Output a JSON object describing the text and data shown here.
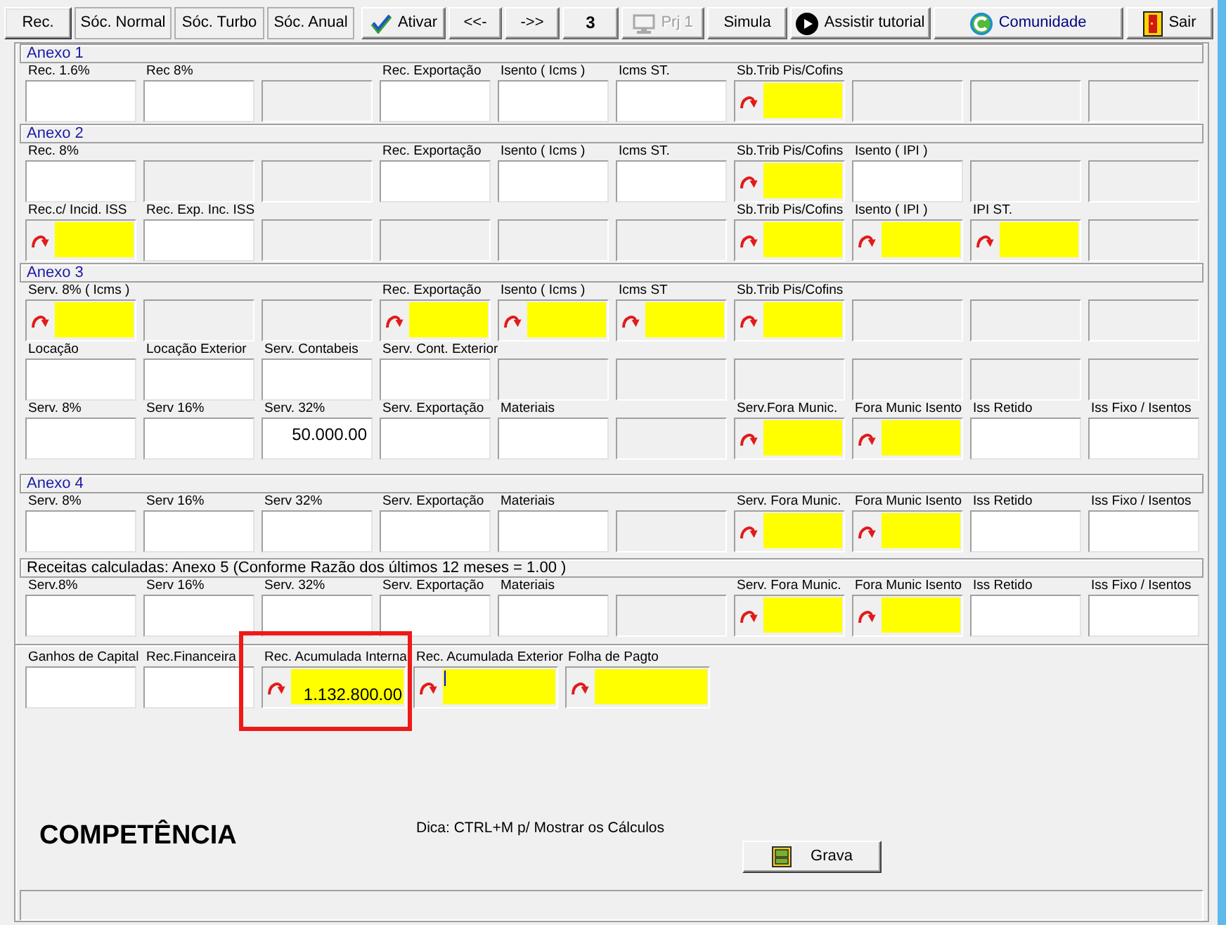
{
  "tabs": [
    {
      "label": "Rec.",
      "selected": true
    },
    {
      "label": "Sóc. Normal",
      "selected": false
    },
    {
      "label": "Sóc. Turbo",
      "selected": false
    },
    {
      "label": "Sóc. Anual",
      "selected": false
    }
  ],
  "toolbar": [
    {
      "kind": "activate",
      "label": "Ativar",
      "disabled": false
    },
    {
      "kind": "plain",
      "label": "<<-",
      "disabled": false
    },
    {
      "kind": "plain",
      "label": "->>",
      "disabled": false
    },
    {
      "kind": "counter",
      "label": "3",
      "disabled": false
    },
    {
      "kind": "project",
      "label": "Prj 1",
      "disabled": true
    },
    {
      "kind": "plain",
      "label": "Simula",
      "disabled": false
    },
    {
      "kind": "tutorial",
      "label": "Assistir tutorial",
      "disabled": false
    },
    {
      "kind": "community",
      "label": "Comunidade",
      "disabled": false
    },
    {
      "kind": "exit",
      "label": "Sair",
      "disabled": false
    }
  ],
  "sections": [
    {
      "kind": "annex",
      "title": "Anexo 1",
      "rows": [
        [
          {
            "kind": "input",
            "label": "Rec. 1.6%"
          },
          {
            "kind": "input",
            "label": "Rec 8%"
          },
          {
            "kind": "off"
          },
          {
            "kind": "input",
            "label": "Rec. Exportação"
          },
          {
            "kind": "input",
            "label": "Isento ( Icms )"
          },
          {
            "kind": "input",
            "label": "Icms ST."
          },
          {
            "kind": "calc",
            "label": "Sb.Trib Pis/Cofins"
          },
          {
            "kind": "off"
          },
          {
            "kind": "off"
          },
          {
            "kind": "off"
          }
        ]
      ]
    },
    {
      "kind": "annex",
      "title": "Anexo 2",
      "rows": [
        [
          {
            "kind": "input",
            "label": "Rec. 8%"
          },
          {
            "kind": "off"
          },
          {
            "kind": "off"
          },
          {
            "kind": "input",
            "label": "Rec. Exportação"
          },
          {
            "kind": "input",
            "label": "Isento ( Icms )"
          },
          {
            "kind": "input",
            "label": "Icms ST."
          },
          {
            "kind": "calc",
            "label": "Sb.Trib Pis/Cofins"
          },
          {
            "kind": "input",
            "label": "Isento ( IPI )"
          },
          {
            "kind": "off"
          },
          {
            "kind": "off"
          }
        ],
        [
          {
            "kind": "calc",
            "label": "Rec.c/ Incid. ISS"
          },
          {
            "kind": "input",
            "label": "Rec. Exp. Inc. ISS"
          },
          {
            "kind": "off"
          },
          {
            "kind": "off"
          },
          {
            "kind": "off"
          },
          {
            "kind": "off"
          },
          {
            "kind": "calc",
            "label": "Sb.Trib Pis/Cofins"
          },
          {
            "kind": "calc",
            "label": "Isento ( IPI )"
          },
          {
            "kind": "calc",
            "label": "IPI ST."
          },
          {
            "kind": "off"
          }
        ]
      ]
    },
    {
      "kind": "annex",
      "title": "Anexo 3",
      "rows": [
        [
          {
            "kind": "calc",
            "label": "Serv. 8% ( Icms )"
          },
          {
            "kind": "off"
          },
          {
            "kind": "off"
          },
          {
            "kind": "calc",
            "label": "Rec. Exportação"
          },
          {
            "kind": "calc",
            "label": "Isento ( Icms )"
          },
          {
            "kind": "calc",
            "label": "Icms ST"
          },
          {
            "kind": "calc",
            "label": "Sb.Trib Pis/Cofins"
          },
          {
            "kind": "off"
          },
          {
            "kind": "off"
          },
          {
            "kind": "off"
          }
        ],
        [
          {
            "kind": "input",
            "label": "Locação"
          },
          {
            "kind": "input",
            "label": "Locação Exterior"
          },
          {
            "kind": "input",
            "label": "Serv. Contabeis"
          },
          {
            "kind": "input",
            "label": "Serv. Cont. Exterior"
          },
          {
            "kind": "off"
          },
          {
            "kind": "off"
          },
          {
            "kind": "off"
          },
          {
            "kind": "off"
          },
          {
            "kind": "off"
          },
          {
            "kind": "off"
          }
        ],
        [
          {
            "kind": "input",
            "label": "Serv. 8%"
          },
          {
            "kind": "input",
            "label": "Serv 16%"
          },
          {
            "kind": "input",
            "label": "Serv. 32%",
            "value": "50.000.00"
          },
          {
            "kind": "input",
            "label": "Serv. Exportação"
          },
          {
            "kind": "input",
            "label": "Materiais"
          },
          {
            "kind": "off"
          },
          {
            "kind": "calc",
            "label": "Serv.Fora Munic."
          },
          {
            "kind": "calc",
            "label": "Fora Munic Isento"
          },
          {
            "kind": "input",
            "label": "Iss Retido"
          },
          {
            "kind": "input",
            "label": "Iss Fixo / Isentos"
          }
        ]
      ]
    },
    {
      "kind": "annex",
      "title": "Anexo 4",
      "rows": [
        [
          {
            "kind": "input",
            "label": "Serv. 8%"
          },
          {
            "kind": "input",
            "label": "Serv 16%"
          },
          {
            "kind": "input",
            "label": "Serv 32%"
          },
          {
            "kind": "input",
            "label": "Serv. Exportação"
          },
          {
            "kind": "input",
            "label": "Materiais"
          },
          {
            "kind": "off"
          },
          {
            "kind": "calc",
            "label": "Serv. Fora Munic."
          },
          {
            "kind": "calc",
            "label": "Fora Munic Isento"
          },
          {
            "kind": "input",
            "label": "Iss Retido"
          },
          {
            "kind": "input",
            "label": "Iss Fixo / Isentos"
          }
        ]
      ]
    },
    {
      "kind": "computed",
      "title": "Receitas calculadas: Anexo 5 (Conforme Razão dos últimos 12 meses = 1.00 )",
      "rows": [
        [
          {
            "kind": "input",
            "label": "Serv.8%"
          },
          {
            "kind": "input",
            "label": "Serv 16%"
          },
          {
            "kind": "input",
            "label": "Serv. 32%"
          },
          {
            "kind": "input",
            "label": "Serv. Exportação"
          },
          {
            "kind": "input",
            "label": "Materiais"
          },
          {
            "kind": "off"
          },
          {
            "kind": "calc",
            "label": "Serv. Fora Munic."
          },
          {
            "kind": "calc",
            "label": "Fora Munic Isento"
          },
          {
            "kind": "input",
            "label": "Iss Retido"
          },
          {
            "kind": "input",
            "label": "Iss Fixo / Isentos"
          }
        ]
      ]
    }
  ],
  "extra_row": [
    {
      "kind": "input",
      "label": "Ganhos de Capital",
      "highlighted": false,
      "focused": false
    },
    {
      "kind": "input",
      "label": "Rec.Financeira",
      "highlighted": false,
      "focused": false
    },
    {
      "kind": "calc",
      "label": "Rec. Acumulada Interna",
      "value": "1.132.800.00",
      "highlighted": true,
      "focused": false
    },
    {
      "kind": "calc",
      "label": "Rec. Acumulada Exterior",
      "highlighted": false,
      "focused": true
    },
    {
      "kind": "calc",
      "label": "Folha de Pagto",
      "highlighted": false,
      "focused": false
    }
  ],
  "footer": {
    "heading": "COMPETÊNCIA",
    "hint": "Dica: CTRL+M p/ Mostrar os Cálculos",
    "save_button": "Grava"
  }
}
